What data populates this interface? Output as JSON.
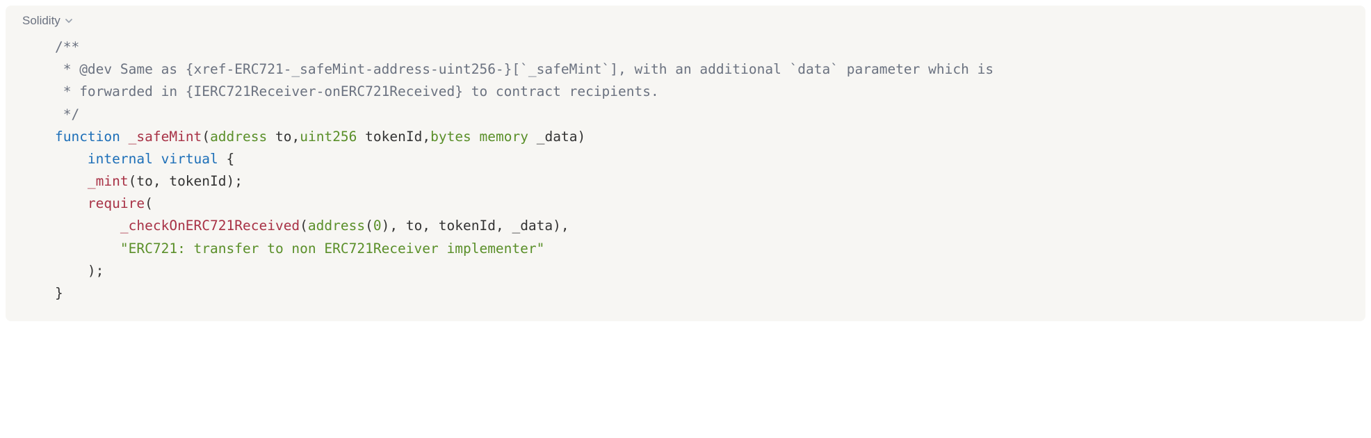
{
  "header": {
    "language": "Solidity"
  },
  "code": {
    "comment_line1": "/**",
    "comment_line2": " * @dev Same as {xref-ERC721-_safeMint-address-uint256-}[`_safeMint`], with an additional `data` parameter which is",
    "comment_line3": " * forwarded in {IERC721Receiver-onERC721Received} to contract recipients.",
    "comment_line4": " */",
    "kw_function": "function",
    "fn_safeMint": "_safeMint",
    "ty_address1": "address",
    "pm_to": " to",
    "ty_uint256": "uint256",
    "pm_tokenId": " tokenId",
    "ty_bytes": "bytes",
    "ty_memory": "memory",
    "pm_data": " _data",
    "kw_internal": "internal",
    "kw_virtual": "virtual",
    "brace_open": " {",
    "fn_mint": "_mint",
    "args_mint": "(to, tokenId);",
    "fn_require": "require",
    "paren_open": "(",
    "fn_check": "_checkOnERC721Received",
    "ty_address2": "address",
    "num_zero": "0",
    "args_check_tail": "), to, tokenId, _data),",
    "str_msg": "\"ERC721: transfer to non ERC721Receiver implementer\"",
    "paren_close": ");",
    "brace_close": "}"
  }
}
